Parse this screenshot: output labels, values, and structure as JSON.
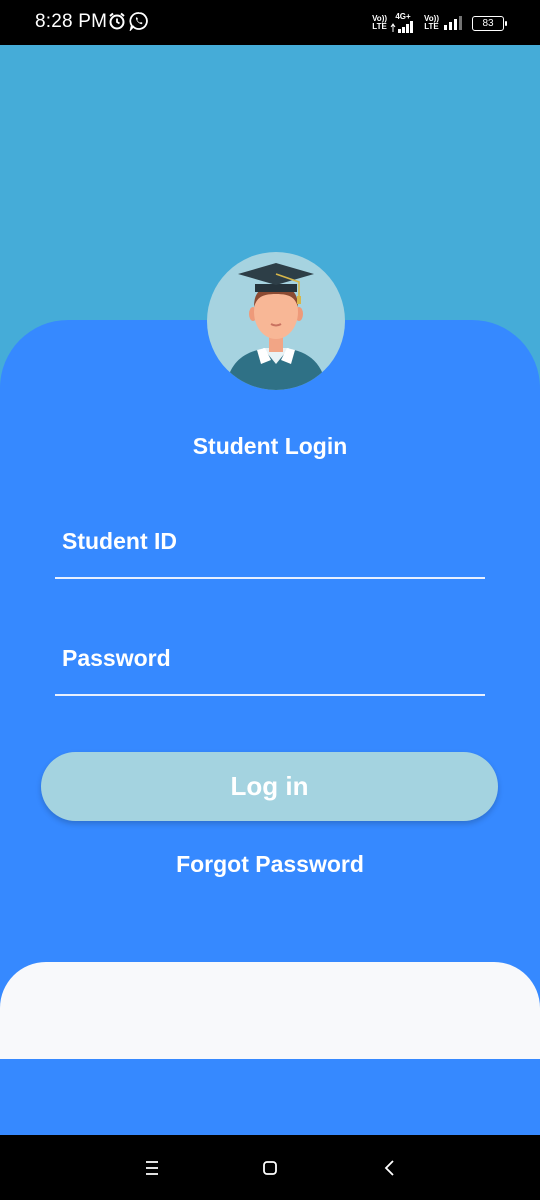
{
  "status_bar": {
    "time": "8:28 PM",
    "icons": [
      "alarm-clock-icon",
      "whatsapp-icon"
    ],
    "sim1": {
      "line1": "Vo))",
      "line2": "LTE",
      "network": "4G+"
    },
    "sim2": {
      "line1": "Vo))",
      "line2": "LTE"
    },
    "battery": "83"
  },
  "login": {
    "title": "Student Login",
    "student_id_label": "Student ID",
    "password_label": "Password",
    "login_button": "Log in",
    "forgot_password": "Forgot Password"
  },
  "colors": {
    "top_band": "#45acd8",
    "card": "#3689ff",
    "button": "#a4d3e0",
    "bottom_panel": "#f8f9fb"
  },
  "nav": {
    "buttons": [
      "menu-icon",
      "home-icon",
      "back-icon"
    ]
  }
}
